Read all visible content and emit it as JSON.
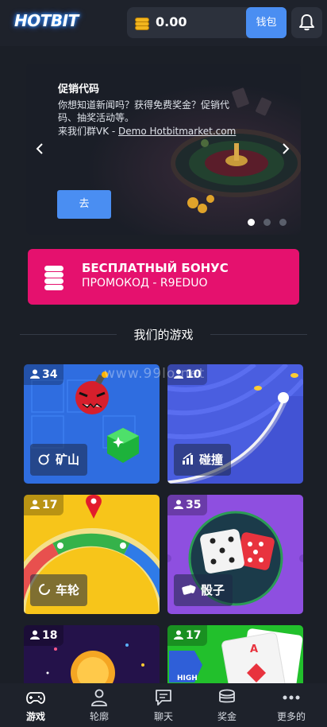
{
  "header": {
    "logo_text": "HOTBIT",
    "balance": "0.00",
    "wallet_label": "钱包"
  },
  "banner": {
    "title": "促销代码",
    "text": "你想知道新闻吗？获得免费奖金？促销代码、抽奖活动等。",
    "link_prefix": "来我们群VK - ",
    "link_text": "Demo Hotbitmarket.com",
    "go_label": "去",
    "active_slide": 1,
    "slide_count": 3
  },
  "bonus": {
    "line1": "БЕСПЛАТНЫЙ БОНУС",
    "line2": "ПРОМОКОД - R9EDUO"
  },
  "section_title": "我们的游戏",
  "watermark": "www.99lo.net",
  "games": [
    {
      "name": "矿山",
      "players": "34",
      "icon": "bomb-icon",
      "color": "#2f6de0"
    },
    {
      "name": "碰撞",
      "players": "10",
      "icon": "chart-bars-icon",
      "color": "#4a5ee0"
    },
    {
      "name": "车轮",
      "players": "17",
      "icon": "spinner-icon",
      "color": "#f7c51a"
    },
    {
      "name": "骰子",
      "players": "35",
      "icon": "dice-icon",
      "color": "#8e4fe0"
    },
    {
      "name": "",
      "players": "18",
      "icon": "coin-icon",
      "color": "#2a1550"
    },
    {
      "name": "",
      "players": "17",
      "icon": "cards-icon",
      "color": "#22c02c",
      "badge": "HIGH"
    }
  ],
  "nav": [
    {
      "label": "游戏",
      "icon": "gamepad-icon",
      "active": true
    },
    {
      "label": "轮廓",
      "icon": "user-icon",
      "active": false
    },
    {
      "label": "聊天",
      "icon": "chat-icon",
      "active": false
    },
    {
      "label": "奖金",
      "icon": "coins-icon",
      "active": false
    },
    {
      "label": "更多的",
      "icon": "more-icon",
      "active": false
    }
  ]
}
